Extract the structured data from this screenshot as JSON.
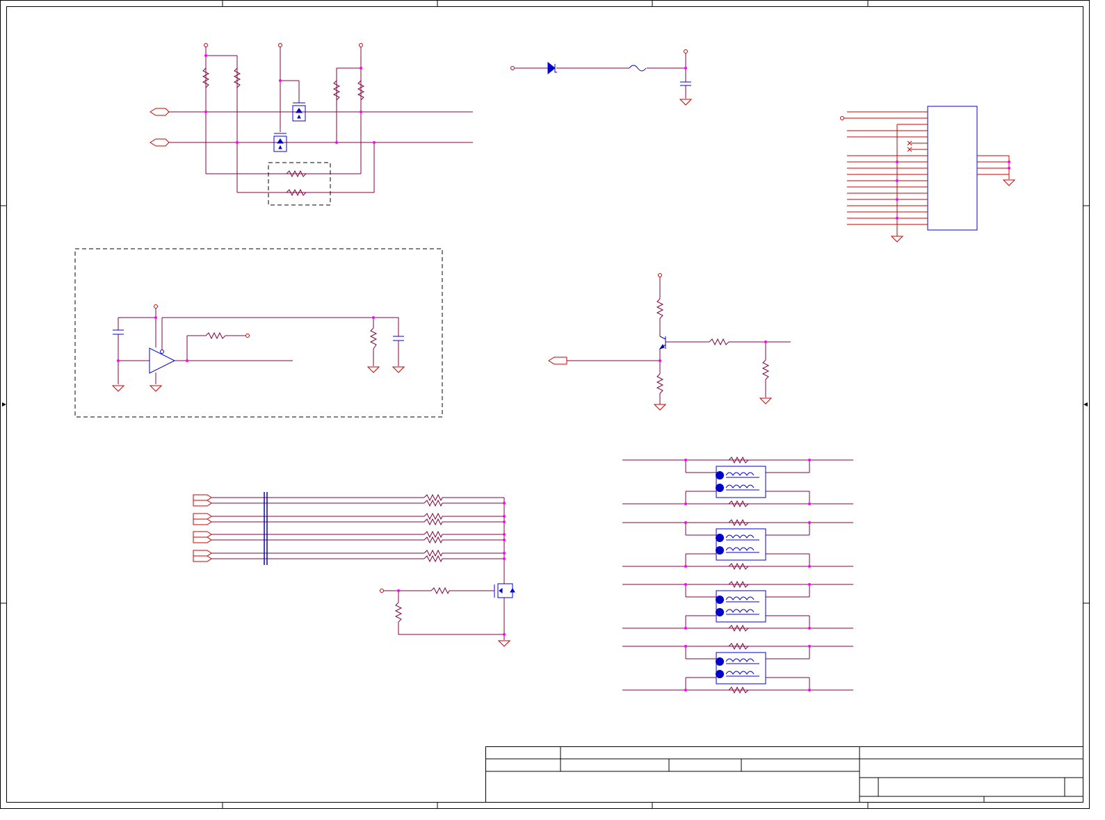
{
  "sheet": {
    "title_block_text": []
  },
  "colors": {
    "frame": "#000000",
    "wire": "#cc0000",
    "net": "#800040",
    "component": "#0000cc",
    "junction": "#ff00ff",
    "dashed_box": "#000000",
    "background": "#ffffff"
  },
  "sections": [
    "pullup-mosfet-level-shifter",
    "diode-fuse-filter",
    "connector-header",
    "opamp-comparator-dashed-group",
    "bjt-switch",
    "coupled-lines-mosfet-switch",
    "common-mode-choke-array"
  ]
}
